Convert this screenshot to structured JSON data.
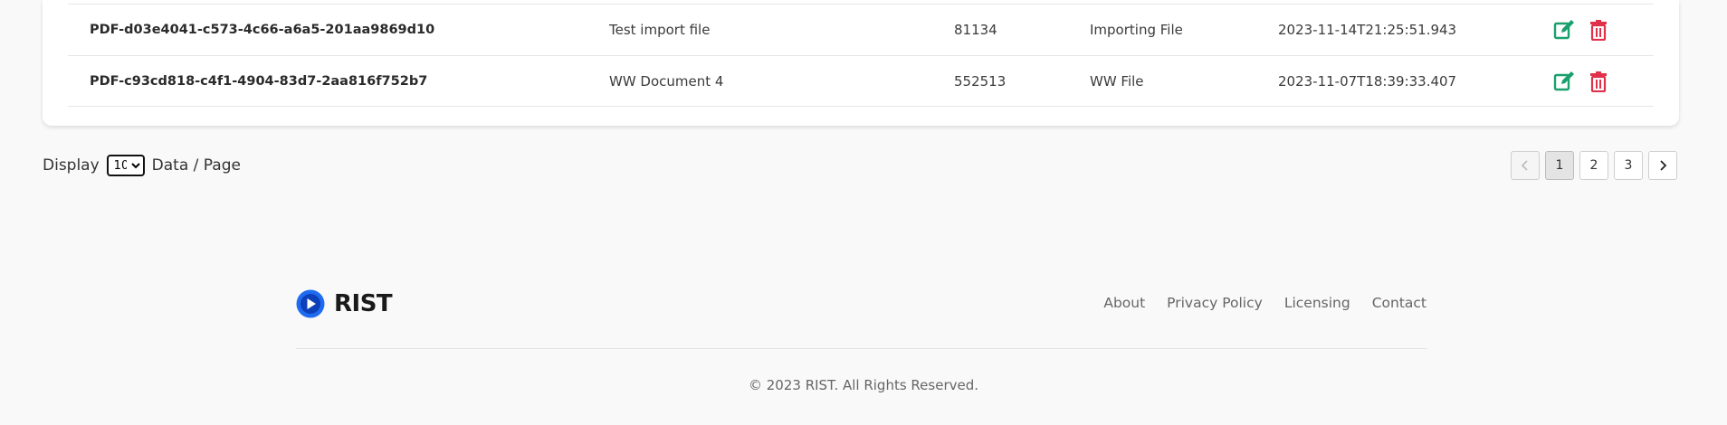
{
  "table": {
    "rows": [
      {
        "id": "PDF-d03e4041-c573-4c66-a6a5-201aa9869d10",
        "name": "Test import file",
        "size": "81134",
        "type": "Importing File",
        "date": "2023-11-14T21:25:51.943"
      },
      {
        "id": "PDF-c93cd818-c4f1-4904-83d7-2aa816f752b7",
        "name": "WW Document 4",
        "size": "552513",
        "type": "WW File",
        "date": "2023-11-07T18:39:33.407"
      }
    ],
    "edit_icon": "edit-icon",
    "delete_icon": "trash-icon",
    "colors": {
      "edit": "#1aa06d",
      "delete": "#e0314b"
    }
  },
  "pagination": {
    "display_label": "Display",
    "per_page_value": "10",
    "per_page_suffix": "Data / Page",
    "pages": [
      "1",
      "2",
      "3"
    ],
    "current_page": "1",
    "prev_icon": "chevron-left-icon",
    "next_icon": "chevron-right-icon"
  },
  "footer": {
    "brand": "RIST",
    "brand_color": "#1e6bf2",
    "links": [
      "About",
      "Privacy Policy",
      "Licensing",
      "Contact"
    ],
    "copyright": "© 2023 RIST. All Rights Reserved."
  }
}
